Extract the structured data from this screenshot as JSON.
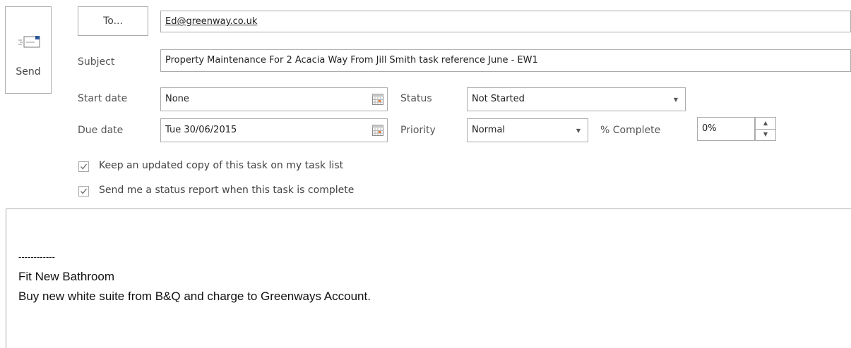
{
  "send": {
    "label": "Send",
    "icon": "envelope-send-icon"
  },
  "to": {
    "button_label": "To...",
    "value": "Ed@greenway.co.uk"
  },
  "subject": {
    "label": "Subject",
    "value": "Property Maintenance For 2 Acacia Way From Jill Smith task reference June - EW1"
  },
  "start_date": {
    "label": "Start date",
    "value": "None"
  },
  "due_date": {
    "label": "Due date",
    "value": "Tue 30/06/2015"
  },
  "status": {
    "label": "Status",
    "value": "Not Started"
  },
  "priority": {
    "label": "Priority",
    "value": "Normal"
  },
  "percent_complete": {
    "label": "% Complete",
    "value": "0%"
  },
  "options": {
    "keep_copy": {
      "label": "Keep an updated copy of this task on my task list",
      "checked": true
    },
    "status_report": {
      "label": "Send me a status report when this task is complete",
      "checked": true
    }
  },
  "body": {
    "separator": "------------",
    "line1": "Fit New Bathroom",
    "line2": "Buy new white suite from B&Q and charge to Greenways Account."
  },
  "colors": {
    "border": "#ababab",
    "accent": "#2b579a",
    "calendar_highlight": "#e8732c"
  }
}
